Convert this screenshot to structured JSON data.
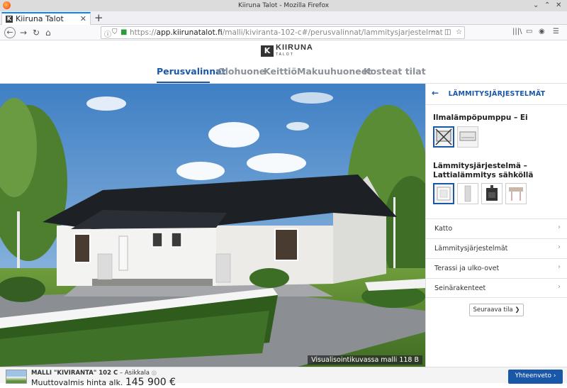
{
  "window": {
    "title": "Kiiruna Talot - Mozilla Firefox",
    "controls": [
      "⌄",
      "⌃",
      "✕"
    ]
  },
  "browser": {
    "tab_label": "Kiiruna Talot",
    "tab_close": "✕",
    "new_tab": "+",
    "url_host": "app.kiirunatalot.fi",
    "url_prefix": "https://",
    "url_path": "/malli/kiviranta-102-c#/perusvalinnat/lammitysjarjestelmat",
    "url_more": "···"
  },
  "site": {
    "logo_text": "KIIRUNA",
    "logo_sub": "TALOT",
    "nav": [
      {
        "label": "Perusvalinnat",
        "active": true
      },
      {
        "label": "Olohuone",
        "active": false
      },
      {
        "label": "Keittiö",
        "active": false
      },
      {
        "label": "Makuuhuoneet",
        "active": false
      },
      {
        "label": "Kosteat tilat",
        "active": false
      }
    ]
  },
  "hero": {
    "caption": "Visualisointikuvassa malli 118 B"
  },
  "panel": {
    "back_arrow": "←",
    "title": "LÄMMITYSJÄRJESTELMÄT",
    "section1_title": "Ilmalämpöpumppu – Ei",
    "section2_title": "Lämmitysjärjestelmä – Lattialämmitys sähköllä",
    "accordion": [
      {
        "label": "Katto"
      },
      {
        "label": "Lämmitysjärjestelmät"
      },
      {
        "label": "Terassi ja ulko-ovet"
      },
      {
        "label": "Seinärakenteet"
      }
    ],
    "chevron": "›",
    "next_button": "Seuraava tila ❯"
  },
  "bottom": {
    "model_label": "MALLI \"KIVIRANTA\" 102 C",
    "model_suffix": "– Asikkala",
    "price_label": "Muuttovalmis hinta alk.",
    "price_value": "145 900 €",
    "summary_button": "Yhteenveto ›"
  },
  "colors": {
    "accent": "#1b57a8",
    "nav_inactive": "#8a8f98"
  }
}
